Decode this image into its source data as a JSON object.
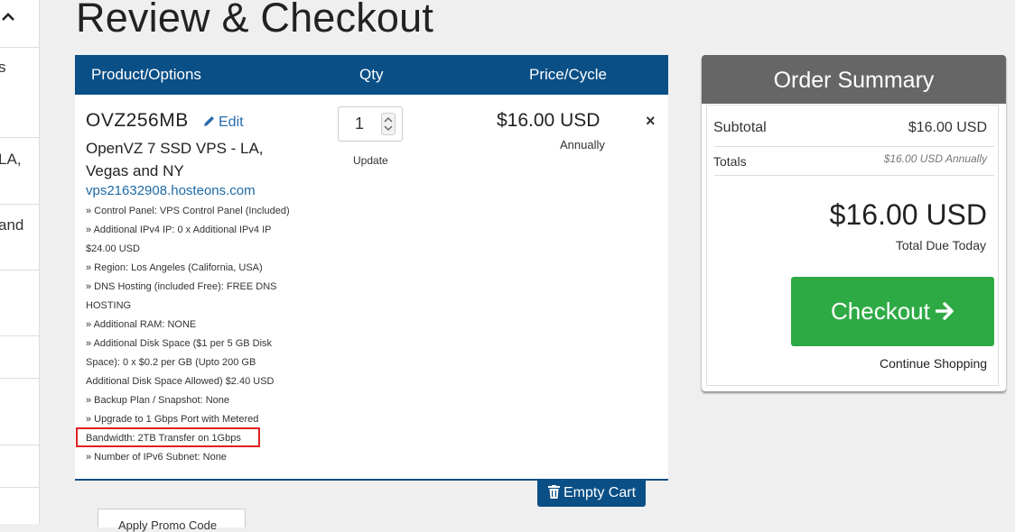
{
  "sidebar": {
    "rows": [
      {
        "text": "s"
      },
      {
        "text": "LA,"
      },
      {
        "text": "and"
      }
    ]
  },
  "page": {
    "title": "Review & Checkout"
  },
  "cart": {
    "headers": {
      "product": "Product/Options",
      "qty": "Qty",
      "price": "Price/Cycle"
    },
    "item": {
      "name": "OVZ256MB",
      "edit_label": "Edit",
      "group": "OpenVZ 7 SSD VPS - LA, Vegas and NY",
      "domain": "vps21632908.hosteons.com",
      "options": [
        "» Control Panel: VPS Control Panel (Included)",
        "» Additional IPv4 IP: 0 x Additional IPv4 IP",
        "$24.00 USD",
        "» Region: Los Angeles (California, USA)",
        "» DNS Hosting (included Free): FREE DNS",
        "HOSTING",
        "» Additional RAM: NONE",
        "» Additional Disk Space ($1 per 5 GB Disk",
        "Space): 0 x $0.2 per GB (Upto 200 GB",
        "Additional Disk Space Allowed) $2.40 USD",
        "» Backup Plan / Snapshot: None",
        "» Upgrade to 1 Gbps Port with Metered",
        "Bandwidth: 2TB Transfer on 1Gbps",
        "» Number of IPv6 Subnet: None"
      ],
      "qty": "1",
      "update_label": "Update",
      "price": "$16.00 USD",
      "cycle": "Annually",
      "remove_icon": "×"
    },
    "empty_cart_label": "Empty Cart",
    "promo_tab_label": "Apply Promo Code"
  },
  "summary": {
    "title": "Order Summary",
    "subtotal_label": "Subtotal",
    "subtotal_value": "$16.00 USD",
    "totals_label": "Totals",
    "totals_note": "$16.00 USD Annually",
    "total_due": "$16.00 USD",
    "total_due_label": "Total Due Today",
    "checkout_label": "Checkout",
    "continue_label": "Continue Shopping"
  },
  "colors": {
    "header_blue": "#0a4f86",
    "checkout_green": "#2eaa45",
    "summary_header": "#666666",
    "highlight_red": "#e02020"
  }
}
